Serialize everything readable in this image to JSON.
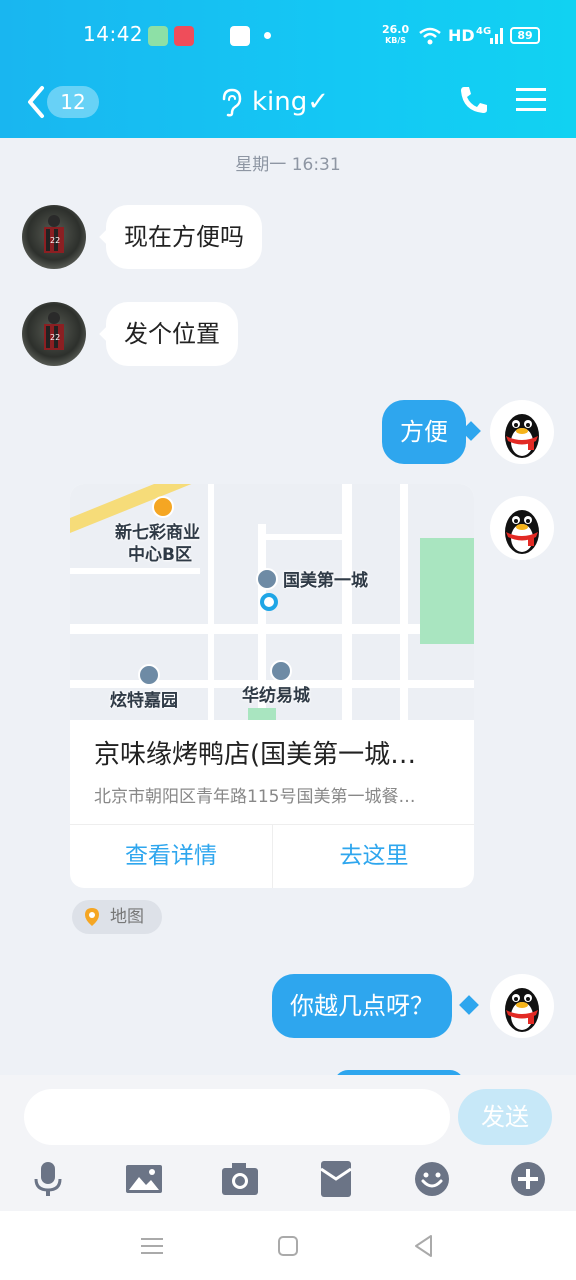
{
  "status_bar": {
    "time": "14:42",
    "speed_value": "26.0",
    "speed_unit": "KB/S",
    "hd": "HD",
    "network": "4G",
    "battery": "89"
  },
  "header": {
    "unread_count": "12",
    "title": "king✓"
  },
  "chat": {
    "timestamp": "星期一 16:31",
    "messages": [
      {
        "from": "other",
        "text": "现在方便吗"
      },
      {
        "from": "other",
        "text": "发个位置"
      },
      {
        "from": "me",
        "text": "方便"
      },
      {
        "from": "me",
        "text": "你越几点呀？"
      }
    ],
    "location_card": {
      "map_labels": [
        "新七彩商业",
        "中心B区",
        "国美第一城",
        "炫特嘉园",
        "华纺易城"
      ],
      "title": "京味缘烤鸭店(国美第一城…",
      "address": "北京市朝阳区青年路115号国美第一城餐…",
      "details_button": "查看详情",
      "go_button": "去这里",
      "tag": "地图"
    }
  },
  "input_bar": {
    "send_label": "发送"
  },
  "colors": {
    "header": "#19b6f0",
    "bubble_out": "#2ea6ee",
    "send_disabled": "#c7e8f8"
  }
}
